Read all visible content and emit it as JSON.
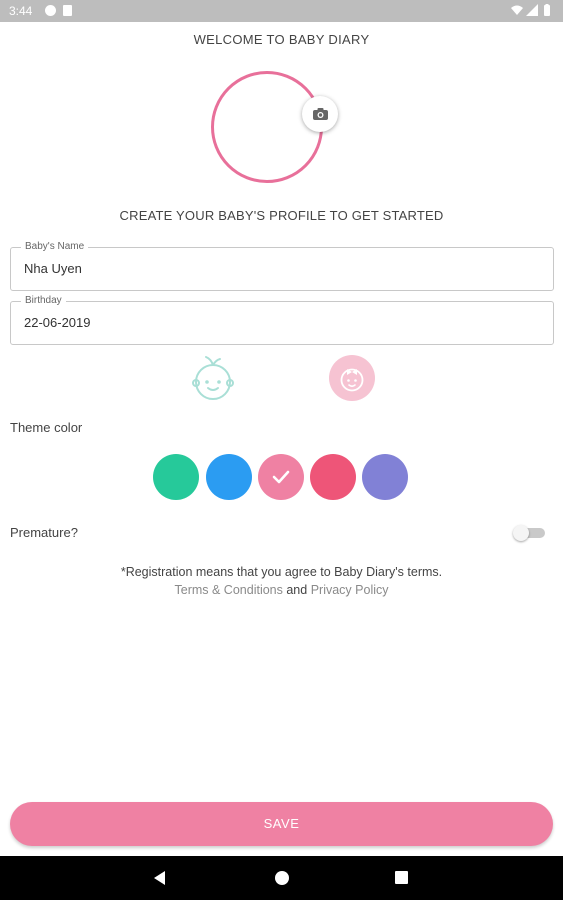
{
  "status_bar": {
    "time": "3:44"
  },
  "header": {
    "welcome": "WELCOME TO BABY DIARY",
    "subtitle": "CREATE YOUR BABY'S PROFILE TO GET STARTED"
  },
  "avatar": {
    "ring_color": "#e8709a",
    "camera_icon": "camera-icon"
  },
  "form": {
    "name": {
      "label": "Baby's Name",
      "value": "Nha Uyen"
    },
    "birthday": {
      "label": "Birthday",
      "value": "22-06-2019"
    }
  },
  "gender": {
    "boy_icon": "baby-boy-icon",
    "girl_icon": "baby-girl-icon",
    "selected": "girl"
  },
  "theme": {
    "label": "Theme color",
    "colors": [
      "#26c99a",
      "#2b9cf2",
      "#ef81a3",
      "#ee5578",
      "#8181d6"
    ],
    "selected_index": 2
  },
  "premature": {
    "label": "Premature?",
    "enabled": false
  },
  "terms": {
    "line": "*Registration means that you agree to Baby Diary's terms.",
    "terms_link": "Terms & Conditions",
    "and": "and",
    "privacy_link": "Privacy Policy"
  },
  "save_label": "SAVE"
}
